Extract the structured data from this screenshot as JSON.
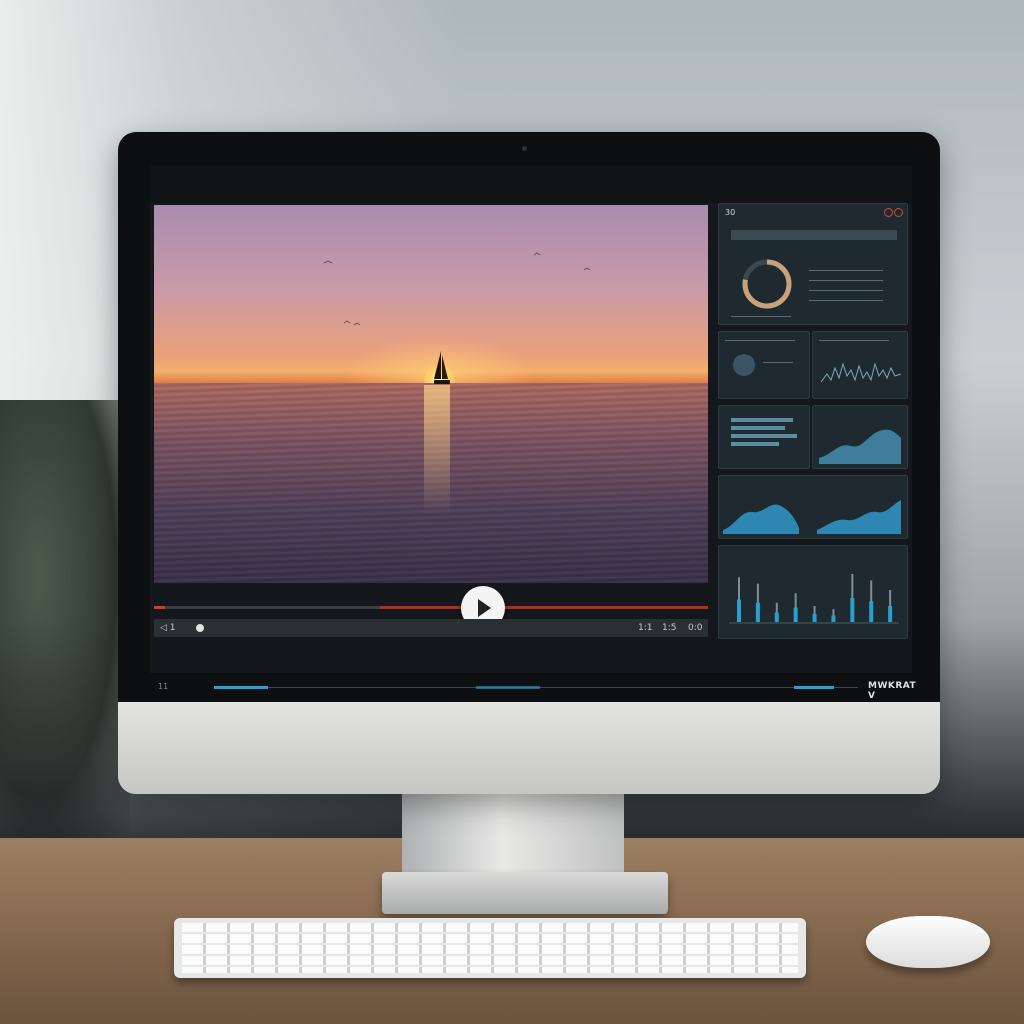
{
  "player": {
    "progress": 0.02,
    "state": "paused",
    "control_left": "◁ 1",
    "control_right_a": "1:1",
    "control_right_b": "1:5",
    "control_right_c": "0:0"
  },
  "topbar": {
    "tab_label": "30"
  },
  "dashboard": {
    "header_field": "",
    "donut_value": 0.78,
    "accent_color": "#2a9fd0",
    "bar_values": [
      0.7,
      0.6,
      0.3,
      0.45,
      0.25,
      0.2,
      0.75,
      0.65,
      0.5
    ]
  },
  "taskbar": {
    "left_label": "11",
    "brand": "MWKRAT V"
  }
}
